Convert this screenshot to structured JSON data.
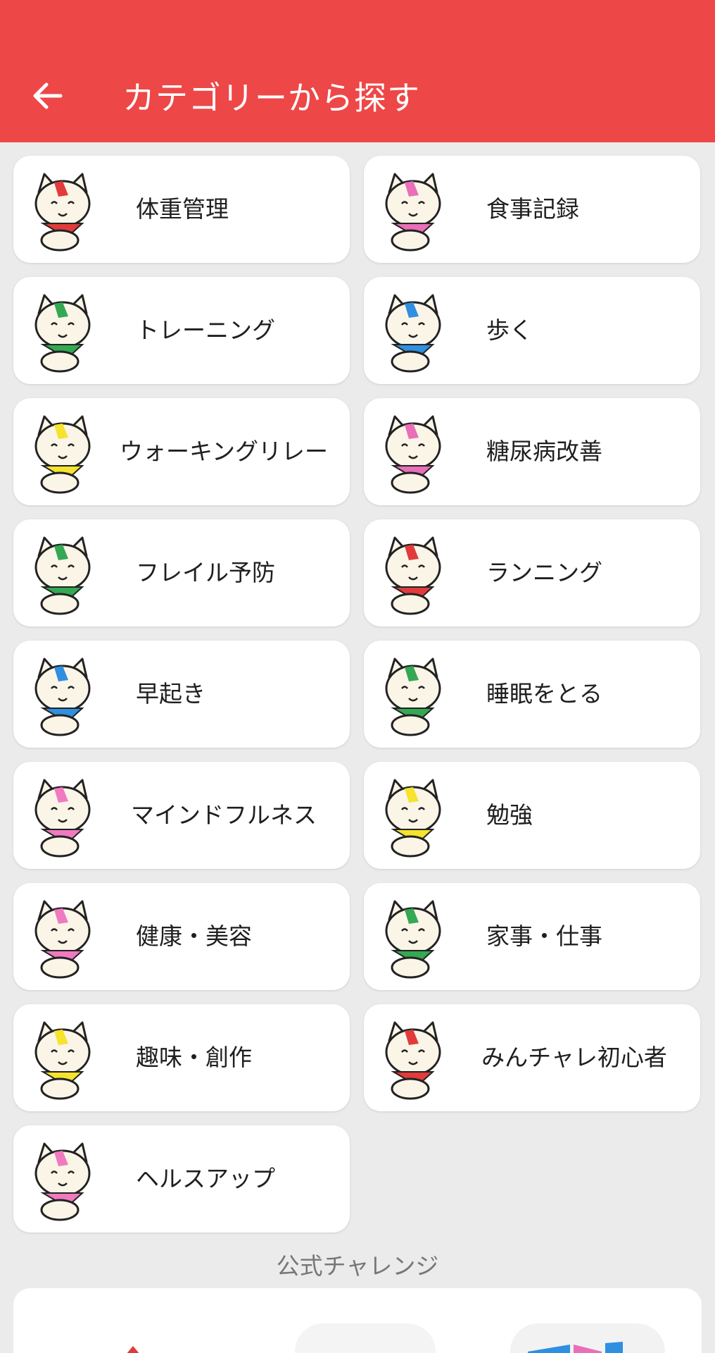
{
  "header": {
    "back_icon": "arrow-left-icon",
    "title": "カテゴリーから探す",
    "color": "#ee4747"
  },
  "categories": [
    {
      "label": "体重管理",
      "scarf": "#e23b3b"
    },
    {
      "label": "食事記録",
      "scarf": "#e86fb8"
    },
    {
      "label": "トレーニング",
      "scarf": "#34a853"
    },
    {
      "label": "歩く",
      "scarf": "#2f8fe0"
    },
    {
      "label": "ウォーキングリレー",
      "scarf": "#f5e32e"
    },
    {
      "label": "糖尿病改善",
      "scarf": "#e86fb8"
    },
    {
      "label": "フレイル予防",
      "scarf": "#34a853"
    },
    {
      "label": "ランニング",
      "scarf": "#e23b3b"
    },
    {
      "label": "早起き",
      "scarf": "#2f8fe0"
    },
    {
      "label": "睡眠をとる",
      "scarf": "#34a853"
    },
    {
      "label": "マインドフルネス",
      "scarf": "#f07ac0"
    },
    {
      "label": "勉強",
      "scarf": "#f5e32e"
    },
    {
      "label": "健康・美容",
      "scarf": "#f07ac0"
    },
    {
      "label": "家事・仕事",
      "scarf": "#34a853"
    },
    {
      "label": "趣味・創作",
      "scarf": "#f5e32e"
    },
    {
      "label": "みんチャレ初心者",
      "scarf": "#e23b3b"
    },
    {
      "label": "ヘルスアップ",
      "scarf": "#f07ac0"
    }
  ],
  "official_section": {
    "title": "公式チャレンジ"
  }
}
